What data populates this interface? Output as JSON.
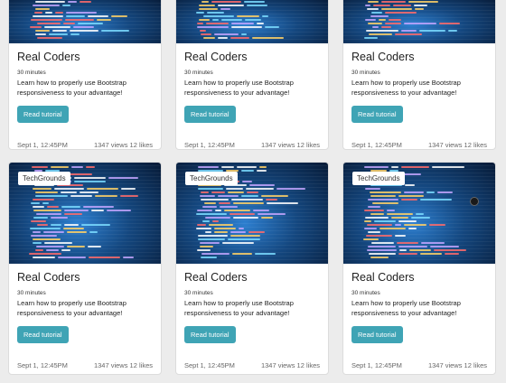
{
  "top_row": [
    {
      "title": "Real Coders",
      "duration": "30 minutes",
      "description": "Learn how to properly use Bootstrap responsiveness to your advantage!",
      "button": "Read tutorial",
      "date": "Sept 1, 12:45PM",
      "stats": "1347 views 12 likes"
    },
    {
      "title": "Real Coders",
      "duration": "30 minutes",
      "description": "Learn how to properly use Bootstrap responsiveness to your advantage!",
      "button": "Read tutorial",
      "date": "Sept 1, 12:45PM",
      "stats": "1347 views 12 likes"
    },
    {
      "title": "Real Coders",
      "duration": "30 minutes",
      "description": "Learn how to properly use Bootstrap responsiveness to your advantage!",
      "button": "Read tutorial",
      "date": "Sept 1, 12:45PM",
      "stats": "1347 views 12 likes"
    }
  ],
  "bottom_row": [
    {
      "badge": "TechGrounds",
      "title": "Real Coders",
      "duration": "30 minutes",
      "description": "Learn how to properly use Bootstrap responsiveness to your advantage!",
      "button": "Read tutorial",
      "date": "Sept 1, 12:45PM",
      "stats": "1347 views 12 likes"
    },
    {
      "badge": "TechGrounds",
      "title": "Real Coders",
      "duration": "30 minutes",
      "description": "Learn how to properly use Bootstrap responsiveness to your advantage!",
      "button": "Read tutorial",
      "date": "Sept 1, 12:45PM",
      "stats": "1347 views 12 likes"
    },
    {
      "badge": "TechGrounds",
      "title": "Real Coders",
      "duration": "30 minutes",
      "description": "Learn how to properly use Bootstrap responsiveness to your advantage!",
      "button": "Read tutorial",
      "date": "Sept 1, 12:45PM",
      "stats": "1347 views 12 likes"
    }
  ],
  "colors": {
    "button": "#3fa4b5",
    "background": "#ececec",
    "card": "#ffffff"
  }
}
